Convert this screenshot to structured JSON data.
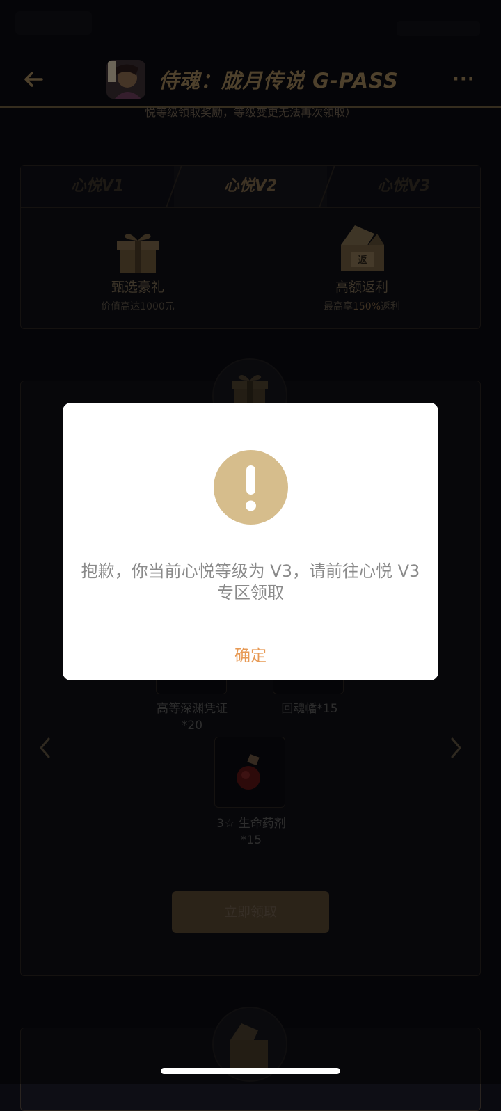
{
  "header": {
    "title": "侍魂：胧月传说 G-PASS",
    "back_icon": "arrow-left-icon",
    "more_icon": "more-dots-icon",
    "more_label": "···"
  },
  "notice": "悦等级领取奖励，等级变更无法再次领取）",
  "benefits": {
    "tabs": [
      "心悦V1",
      "心悦V2",
      "心悦V3"
    ],
    "selected_tab": "心悦V2",
    "items": [
      {
        "title": "甄选豪礼",
        "subtitle": "价值高达1000元",
        "icon": "gift-box-icon"
      },
      {
        "title": "高额返利",
        "subtitle_prefix": "最高享",
        "subtitle_highlight": "150%",
        "subtitle_suffix": "返利",
        "icon": "rebate-box-icon",
        "icon_text": "返"
      }
    ]
  },
  "rewards": {
    "items": [
      {
        "name": "高等深渊凭证",
        "qty": "*20"
      },
      {
        "name": "回魂幡*15",
        "qty": ""
      },
      {
        "name": "3☆ 生命药剂",
        "qty": "*15"
      }
    ],
    "claim_label": "立即领取"
  },
  "modal": {
    "icon": "exclamation-icon",
    "message": "抱歉，你当前心悦等级为 V3，请前往心悦 V3 专区领取",
    "confirm_label": "确定"
  },
  "colors": {
    "gold": "#c8b487",
    "confirm": "#e79a55",
    "background": "#0a0a10"
  }
}
